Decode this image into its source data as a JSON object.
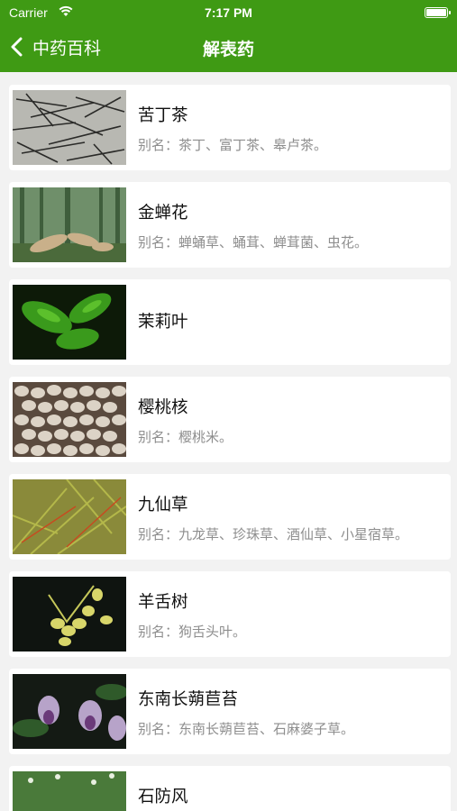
{
  "status_bar": {
    "carrier": "Carrier",
    "time": "7:17 PM"
  },
  "nav": {
    "back_label": "中药百科",
    "title": "解表药"
  },
  "items": [
    {
      "name": "苦丁茶",
      "alias": "别名：茶丁、富丁茶、皋卢茶。",
      "image_icon": "herb-tea-leaves-image"
    },
    {
      "name": "金蝉花",
      "alias": "别名：蝉蛹草、蛹茸、蝉茸菌、虫花。",
      "image_icon": "cicada-flower-image"
    },
    {
      "name": "茉莉叶",
      "alias": "",
      "image_icon": "jasmine-leaf-image"
    },
    {
      "name": "樱桃核",
      "alias": "别名：樱桃米。",
      "image_icon": "cherry-pit-image"
    },
    {
      "name": "九仙草",
      "alias": "别名：九龙草、珍珠草、酒仙草、小星宿草。",
      "image_icon": "herb-plant-image"
    },
    {
      "name": "羊舌树",
      "alias": "别名：狗舌头叶。",
      "image_icon": "fruit-branch-image"
    },
    {
      "name": "东南长蒴苣苔",
      "alias": "别名：东南长蒴苣苔、石麻婆子草。",
      "image_icon": "purple-flower-image"
    },
    {
      "name": "石防风",
      "alias": "",
      "image_icon": "plant-image"
    }
  ],
  "colors": {
    "header": "#3f9a14",
    "background": "#f2f2f2",
    "alias_text": "#8e8e8e"
  }
}
